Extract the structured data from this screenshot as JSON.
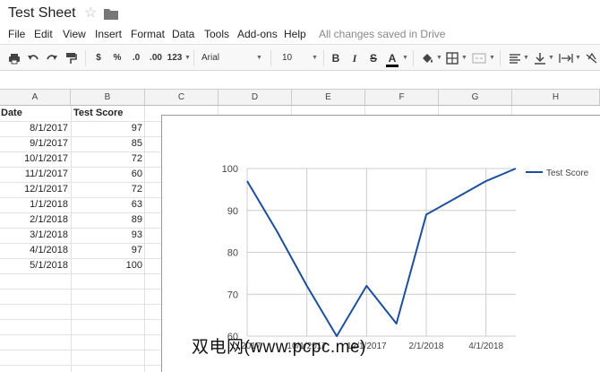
{
  "app": {
    "doc_title": "Test Sheet",
    "star_icon": "star-icon",
    "folder_icon": "folder-icon"
  },
  "menu": {
    "items": [
      "File",
      "Edit",
      "View",
      "Insert",
      "Format",
      "Data",
      "Tools",
      "Add-ons",
      "Help"
    ],
    "save_status": "All changes saved in Drive"
  },
  "toolbar": {
    "currency": "$",
    "percent": "%",
    "decrease_decimals": ".0",
    "increase_decimals": ".00",
    "more_formats": "123",
    "font": "Arial",
    "font_size": "10",
    "bold": "B",
    "italic": "I",
    "strikethrough": "S",
    "text_color": "A",
    "text_color_value": "#000000",
    "icons": [
      "print-icon",
      "undo-icon",
      "redo-icon",
      "paint-format-icon",
      "fill-color-icon",
      "borders-icon",
      "merge-cells-icon",
      "align-icon",
      "valign-icon",
      "text-wrap-icon",
      "text-rotate-icon"
    ]
  },
  "sheet": {
    "columns": [
      "A",
      "B",
      "C",
      "D",
      "E",
      "F",
      "G",
      "H"
    ],
    "header_row": [
      "Date",
      "Test Score"
    ],
    "rows": [
      [
        "8/1/2017",
        "97"
      ],
      [
        "9/1/2017",
        "85"
      ],
      [
        "10/1/2017",
        "72"
      ],
      [
        "11/1/2017",
        "60"
      ],
      [
        "12/1/2017",
        "72"
      ],
      [
        "1/1/2018",
        "63"
      ],
      [
        "2/1/2018",
        "89"
      ],
      [
        "3/1/2018",
        "93"
      ],
      [
        "4/1/2018",
        "97"
      ],
      [
        "5/1/2018",
        "100"
      ]
    ]
  },
  "chart_data": {
    "type": "line",
    "x": [
      "8/1/2017",
      "9/1/2017",
      "10/1/2017",
      "11/1/2017",
      "12/1/2017",
      "1/1/2018",
      "2/1/2018",
      "3/1/2018",
      "4/1/2018",
      "5/1/2018"
    ],
    "series": [
      {
        "name": "Test Score",
        "values": [
          97,
          85,
          72,
          60,
          72,
          63,
          89,
          93,
          97,
          100
        ],
        "color": "#1c4f9c"
      }
    ],
    "ylim": [
      60,
      100
    ],
    "yticks": [
      "100",
      "90",
      "80",
      "70",
      "60"
    ],
    "xticks": [
      "8/1/2017",
      "10/1/2017",
      "12/1/2017",
      "2/1/2018",
      "4/1/2018"
    ],
    "xtick_display": [
      "...2017",
      "10/1/2017",
      "12/1/2017",
      "2/1/2018",
      "4/1/2018"
    ],
    "legend_position": "right",
    "grid": true,
    "title": "",
    "xlabel": "",
    "ylabel": ""
  },
  "watermark": "双电网(www.pcpc.me)"
}
